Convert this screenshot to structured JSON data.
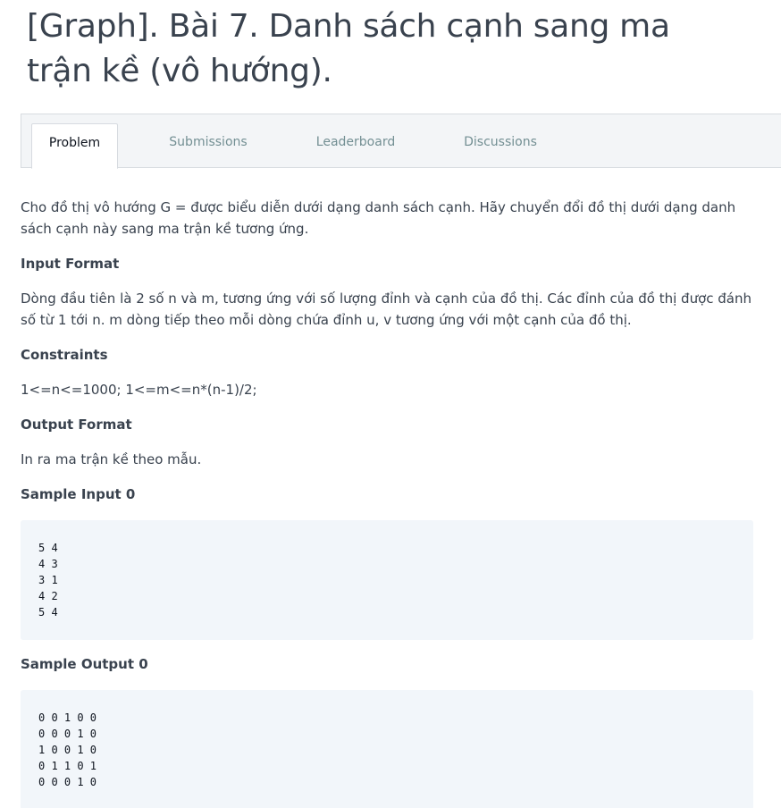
{
  "title": "[Graph]. Bài 7. Danh sách cạnh sang ma trận kề (vô hướng).",
  "tabs": [
    {
      "label": "Problem",
      "active": true
    },
    {
      "label": "Submissions",
      "active": false
    },
    {
      "label": "Leaderboard",
      "active": false
    },
    {
      "label": "Discussions",
      "active": false
    }
  ],
  "problem": {
    "description": "Cho đồ thị vô hướng G = được biểu diễn dưới dạng danh sách cạnh. Hãy chuyển đổi đồ thị dưới dạng danh sách cạnh này sang ma trận kề tương ứng.",
    "input_format_heading": "Input Format",
    "input_format": "Dòng đầu tiên là 2 số n và m, tương ứng với số lượng đỉnh và cạnh của đồ thị. Các đỉnh của đồ thị được đánh số từ 1 tới n. m dòng tiếp theo mỗi dòng chứa đỉnh u, v tương ứng với một cạnh của đồ thị.",
    "constraints_heading": "Constraints",
    "constraints": "1<=n<=1000; 1<=m<=n*(n-1)/2;",
    "output_format_heading": "Output Format",
    "output_format": "In ra ma trận kề theo mẫu.",
    "sample_input_heading": "Sample Input 0",
    "sample_input": "5 4\n4 3\n3 1\n4 2\n5 4",
    "sample_output_heading": "Sample Output 0",
    "sample_output": "0 0 1 0 0\n0 0 0 1 0\n1 0 0 1 0\n0 1 1 0 1\n0 0 0 1 0"
  },
  "colors": {
    "text": "#39424e",
    "tab_inactive": "#738f93",
    "tab_active": "#0e141e",
    "code_background": "#f2f6fa",
    "border": "#d7dbe0"
  }
}
